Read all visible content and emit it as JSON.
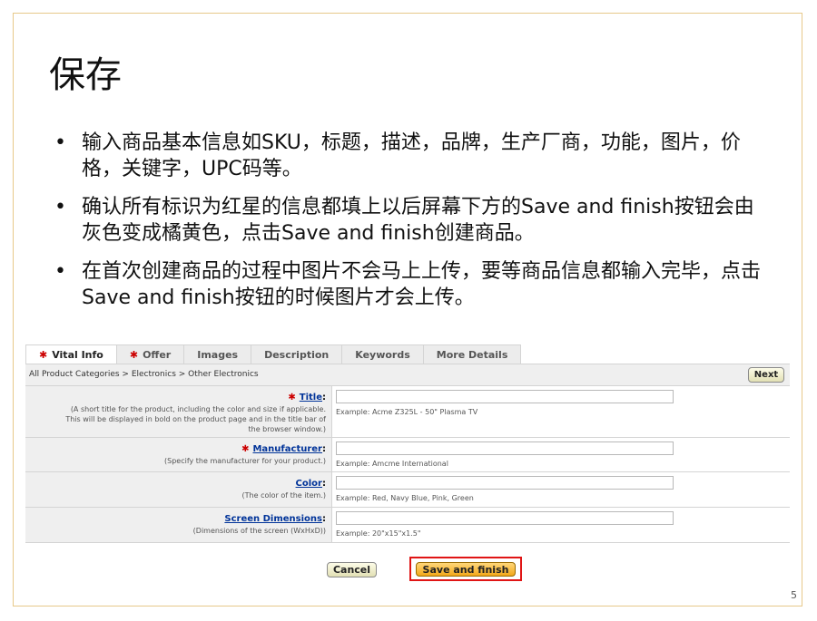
{
  "slide": {
    "title": "保存",
    "page_number": "5",
    "bullet_symbol": "•",
    "bullets": [
      "输入商品基本信息如SKU，标题，描述，品牌，生产厂商，功能，图片，价格，关键字，UPC码等。",
      "确认所有标识为红星的信息都填上以后屏幕下方的Save and finish按钮会由灰色变成橘黄色，点击Save and finish创建商品。",
      "在首次创建商品的过程中图片不会马上上传，要等商品信息都输入完毕，点击Save and finish按钮的时候图片才会上传。"
    ]
  },
  "screenshot": {
    "required_mark": "✱",
    "tabs": [
      {
        "label": "Vital Info",
        "required": true,
        "active": true
      },
      {
        "label": "Offer",
        "required": true,
        "active": false
      },
      {
        "label": "Images",
        "required": false,
        "active": false
      },
      {
        "label": "Description",
        "required": false,
        "active": false
      },
      {
        "label": "Keywords",
        "required": false,
        "active": false
      },
      {
        "label": "More Details",
        "required": false,
        "active": false
      }
    ],
    "breadcrumb": "All Product Categories > Electronics > Other Electronics",
    "next_label": "Next",
    "fields": [
      {
        "name": "Title",
        "required": true,
        "description_lines": [
          "(A short title for the product, including the color and size if applicable.",
          "This will be displayed in bold on the product page and in the title bar of",
          "the browser window.)"
        ],
        "value": "",
        "example": "Example: Acme Z325L - 50\" Plasma TV"
      },
      {
        "name": "Manufacturer",
        "required": true,
        "description_lines": [
          "(Specify the manufacturer for your product.)"
        ],
        "value": "",
        "example": "Example: Amcme International"
      },
      {
        "name": "Color",
        "required": false,
        "description_lines": [
          "(The color of the item.)"
        ],
        "value": "",
        "example": "Example: Red, Navy Blue, Pink, Green"
      },
      {
        "name": "Screen Dimensions",
        "required": false,
        "description_lines": [
          "(Dimensions of the screen (WxHxD))"
        ],
        "value": "",
        "example": "Example: 20\"x15\"x1.5\""
      }
    ],
    "cancel_label": "Cancel",
    "save_label": "Save and finish",
    "colors": {
      "required_star": "#cc0000",
      "save_button": "#f2a81a",
      "highlight_outline": "#e01515",
      "link": "#003399"
    }
  }
}
